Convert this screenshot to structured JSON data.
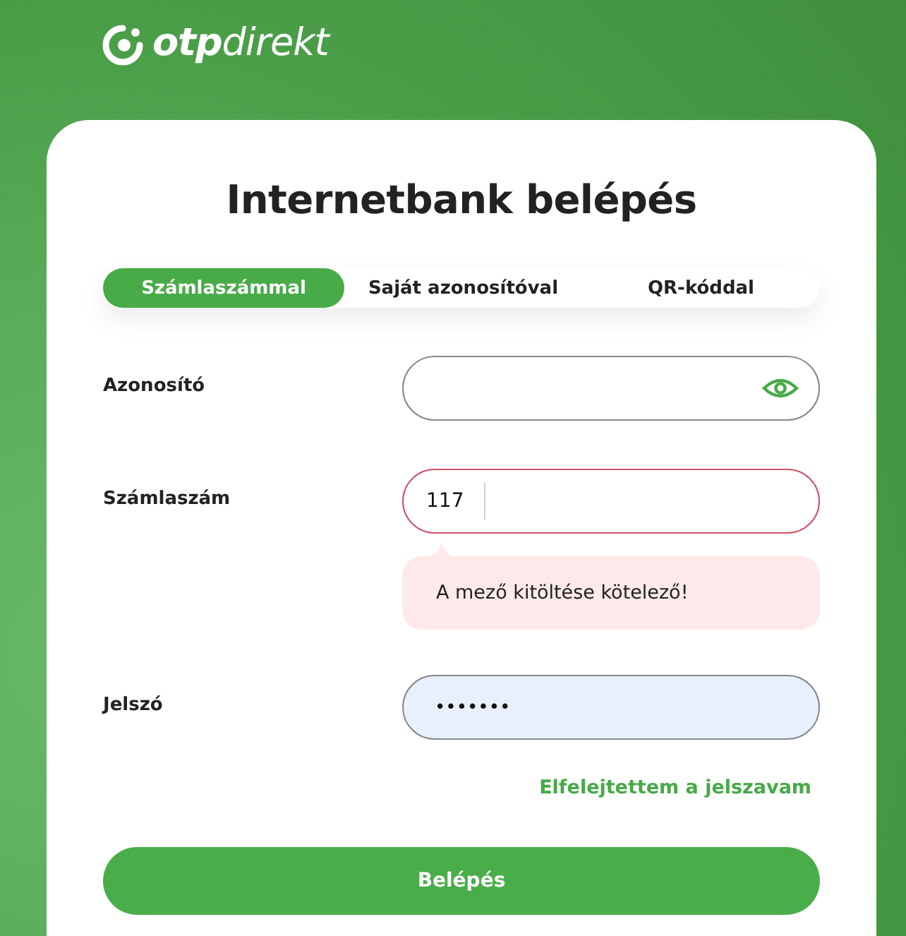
{
  "brand": {
    "logo": "**otp**direkt"
  },
  "title": "Internetbank belépés",
  "tabs": [
    {
      "label": "Számlaszámmal",
      "selected": true
    },
    {
      "label": "Saját azonosítóval",
      "selected": false
    },
    {
      "label": "QR-kóddal",
      "selected": false
    }
  ],
  "fields": [
    {
      "kind": "text",
      "label": "Azonosító",
      "invalid": false,
      "autofilled": false
    },
    {
      "kind": "account",
      "label": "Számlaszám",
      "prefix": "117",
      "invalid": true,
      "autofilled": false,
      "error": "A mező kitöltése kötelező!"
    },
    {
      "kind": "password",
      "label": "Jelszó",
      "value": "•••••••",
      "invalid": false,
      "autofilled": true
    }
  ],
  "forgot_link": "Elfelejtettem a jelszavam",
  "submit": "Belépés"
}
